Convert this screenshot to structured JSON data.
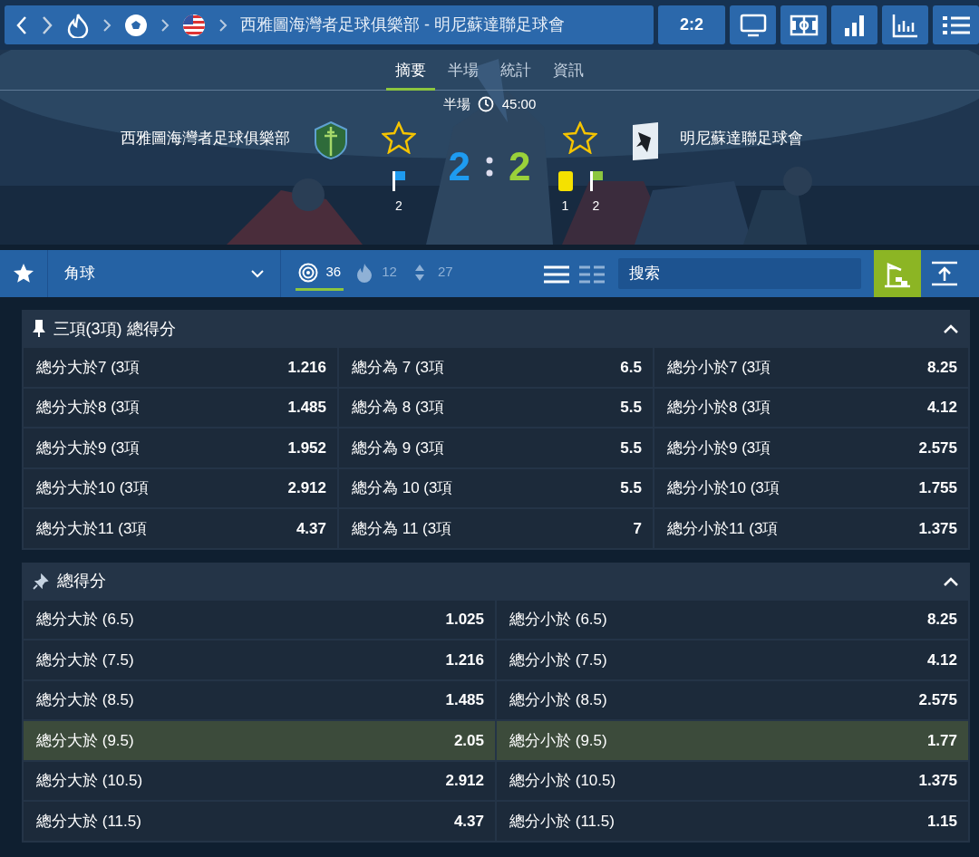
{
  "breadcrumb": {
    "title": "西雅圖海灣者足球俱樂部 - 明尼蘇達聯足球會",
    "score": "2:2"
  },
  "top_tools": [
    {
      "kind": "tv"
    },
    {
      "kind": "field"
    },
    {
      "kind": "bars"
    },
    {
      "kind": "chart"
    },
    {
      "kind": "list"
    }
  ],
  "tabs": [
    {
      "label": "摘要",
      "selected": true
    },
    {
      "label": "半場",
      "selected": false
    },
    {
      "label": "統計",
      "selected": false
    },
    {
      "label": "資訊",
      "selected": false
    }
  ],
  "match": {
    "period": "半場",
    "clock": "45:00",
    "home": {
      "name": "西雅圖海灣者足球俱樂部",
      "favorite": false,
      "score": "2",
      "stats": [
        {
          "kind": "corner",
          "color": "#1e9bf0",
          "count": "2"
        }
      ]
    },
    "away": {
      "name": "明尼蘇達聯足球會",
      "favorite": false,
      "score": "2",
      "stats": [
        {
          "kind": "card",
          "color": "#f5e100",
          "count": "1"
        },
        {
          "kind": "corner",
          "color": "#8cc63f",
          "count": "2"
        }
      ]
    }
  },
  "filter": {
    "market": "角球",
    "counts": [
      {
        "kind": "target",
        "count": "36",
        "selected": true
      },
      {
        "kind": "fire",
        "count": "12",
        "selected": false
      },
      {
        "kind": "updown",
        "count": "27",
        "selected": false
      }
    ],
    "views": [
      {
        "kind": "list",
        "selected": true
      },
      {
        "kind": "grid",
        "selected": false
      }
    ],
    "search": {
      "placeholder": "搜索"
    },
    "tools": [
      {
        "kind": "tree",
        "selected": true
      },
      {
        "kind": "collapse",
        "selected": false
      }
    ]
  },
  "sections": [
    {
      "title": "三項(3項) 總得分",
      "pinned": true,
      "expanded": true,
      "kind": "three_way",
      "odds": [
        {
          "label": "總分大於7 (3項",
          "price": "1.216",
          "selected": false
        },
        {
          "label": "總分為 7 (3項",
          "price": "6.5",
          "selected": false
        },
        {
          "label": "總分小於7 (3項",
          "price": "8.25",
          "selected": false
        },
        {
          "label": "總分大於8 (3項",
          "price": "1.485",
          "selected": false
        },
        {
          "label": "總分為 8 (3項",
          "price": "5.5",
          "selected": false
        },
        {
          "label": "總分小於8 (3項",
          "price": "4.12",
          "selected": false
        },
        {
          "label": "總分大於9 (3項",
          "price": "1.952",
          "selected": false
        },
        {
          "label": "總分為 9 (3項",
          "price": "5.5",
          "selected": false
        },
        {
          "label": "總分小於9 (3項",
          "price": "2.575",
          "selected": false
        },
        {
          "label": "總分大於10 (3項",
          "price": "2.912",
          "selected": false
        },
        {
          "label": "總分為 10 (3項",
          "price": "5.5",
          "selected": false
        },
        {
          "label": "總分小於10 (3項",
          "price": "1.755",
          "selected": false
        },
        {
          "label": "總分大於11 (3項",
          "price": "4.37",
          "selected": false
        },
        {
          "label": "總分為 11 (3項",
          "price": "7",
          "selected": false
        },
        {
          "label": "總分小於11 (3項",
          "price": "1.375",
          "selected": false
        }
      ]
    },
    {
      "title": "總得分",
      "pinned": false,
      "expanded": true,
      "kind": "over_under",
      "odds": [
        {
          "label": "總分大於 (6.5)",
          "price": "1.025",
          "selected": false
        },
        {
          "label": "總分小於 (6.5)",
          "price": "8.25",
          "selected": false
        },
        {
          "label": "總分大於 (7.5)",
          "price": "1.216",
          "selected": false
        },
        {
          "label": "總分小於 (7.5)",
          "price": "4.12",
          "selected": false
        },
        {
          "label": "總分大於 (8.5)",
          "price": "1.485",
          "selected": false
        },
        {
          "label": "總分小於 (8.5)",
          "price": "2.575",
          "selected": false
        },
        {
          "label": "總分大於 (9.5)",
          "price": "2.05",
          "selected": true
        },
        {
          "label": "總分小於 (9.5)",
          "price": "1.77",
          "selected": true
        },
        {
          "label": "總分大於 (10.5)",
          "price": "2.912",
          "selected": false
        },
        {
          "label": "總分小於 (10.5)",
          "price": "1.375",
          "selected": false
        },
        {
          "label": "總分大於 (11.5)",
          "price": "4.37",
          "selected": false
        },
        {
          "label": "總分小於 (11.5)",
          "price": "1.15",
          "selected": false
        }
      ]
    }
  ]
}
